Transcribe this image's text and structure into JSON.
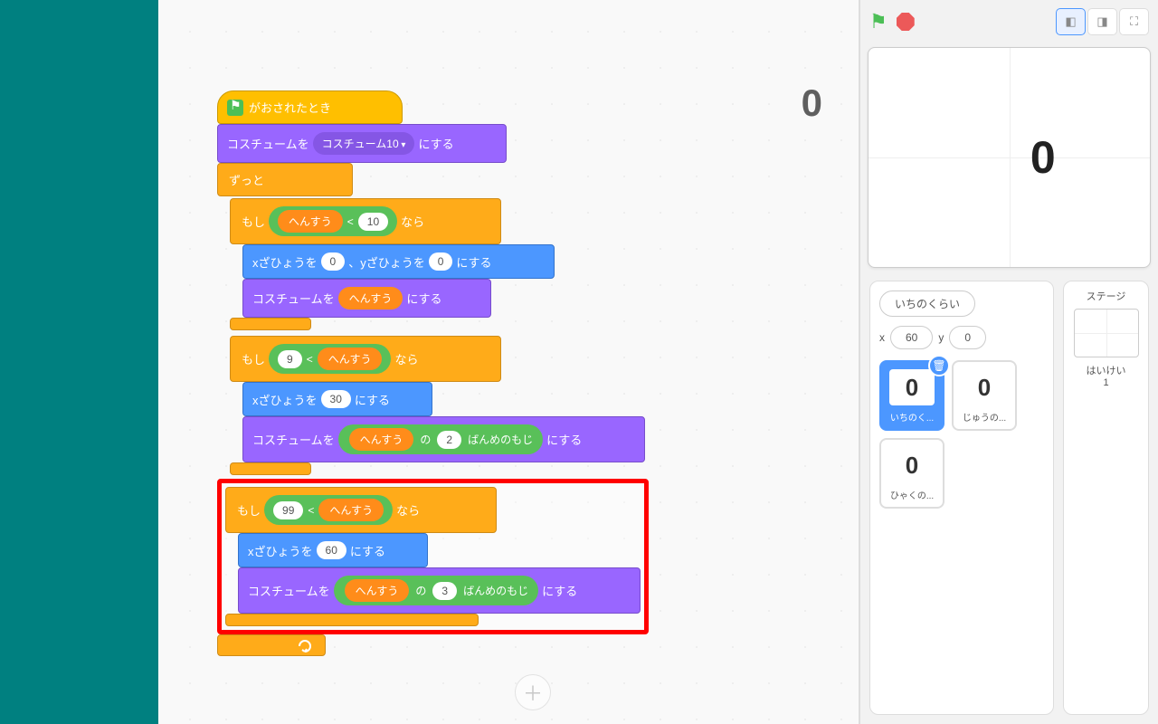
{
  "counter": "0",
  "blocks": {
    "flag_clicked": "がおされたとき",
    "switch_costume_to": "コスチュームを",
    "costume_suffix": "にする",
    "costume10": "コスチューム10",
    "forever": "ずっと",
    "if": "もし",
    "then": "なら",
    "variable": "へんすう",
    "lt": "<",
    "val10": "10",
    "val9": "9",
    "val99": "99",
    "set_x": "xざひょうを",
    "set_y": "、yざひょうを",
    "set_suffix": "にする",
    "x0": "0",
    "y0": "0",
    "x30": "30",
    "x60": "60",
    "letter_of": "の",
    "letter_suffix": "ばんめのもじ",
    "letter2": "2",
    "letter3": "3"
  },
  "stage": {
    "digit": "0",
    "label": "ステージ",
    "backdrops_label": "はいけい",
    "backdrops_count": "1"
  },
  "sprites": {
    "name_label": "いちのくらい",
    "x_label": "x",
    "y_label": "y",
    "x_val": "60",
    "y_val": "0",
    "list": [
      {
        "thumb": "0",
        "name": "いちのく..."
      },
      {
        "thumb": "0",
        "name": "じゅうの..."
      },
      {
        "thumb": "0",
        "name": "ひゃくの..."
      }
    ]
  }
}
